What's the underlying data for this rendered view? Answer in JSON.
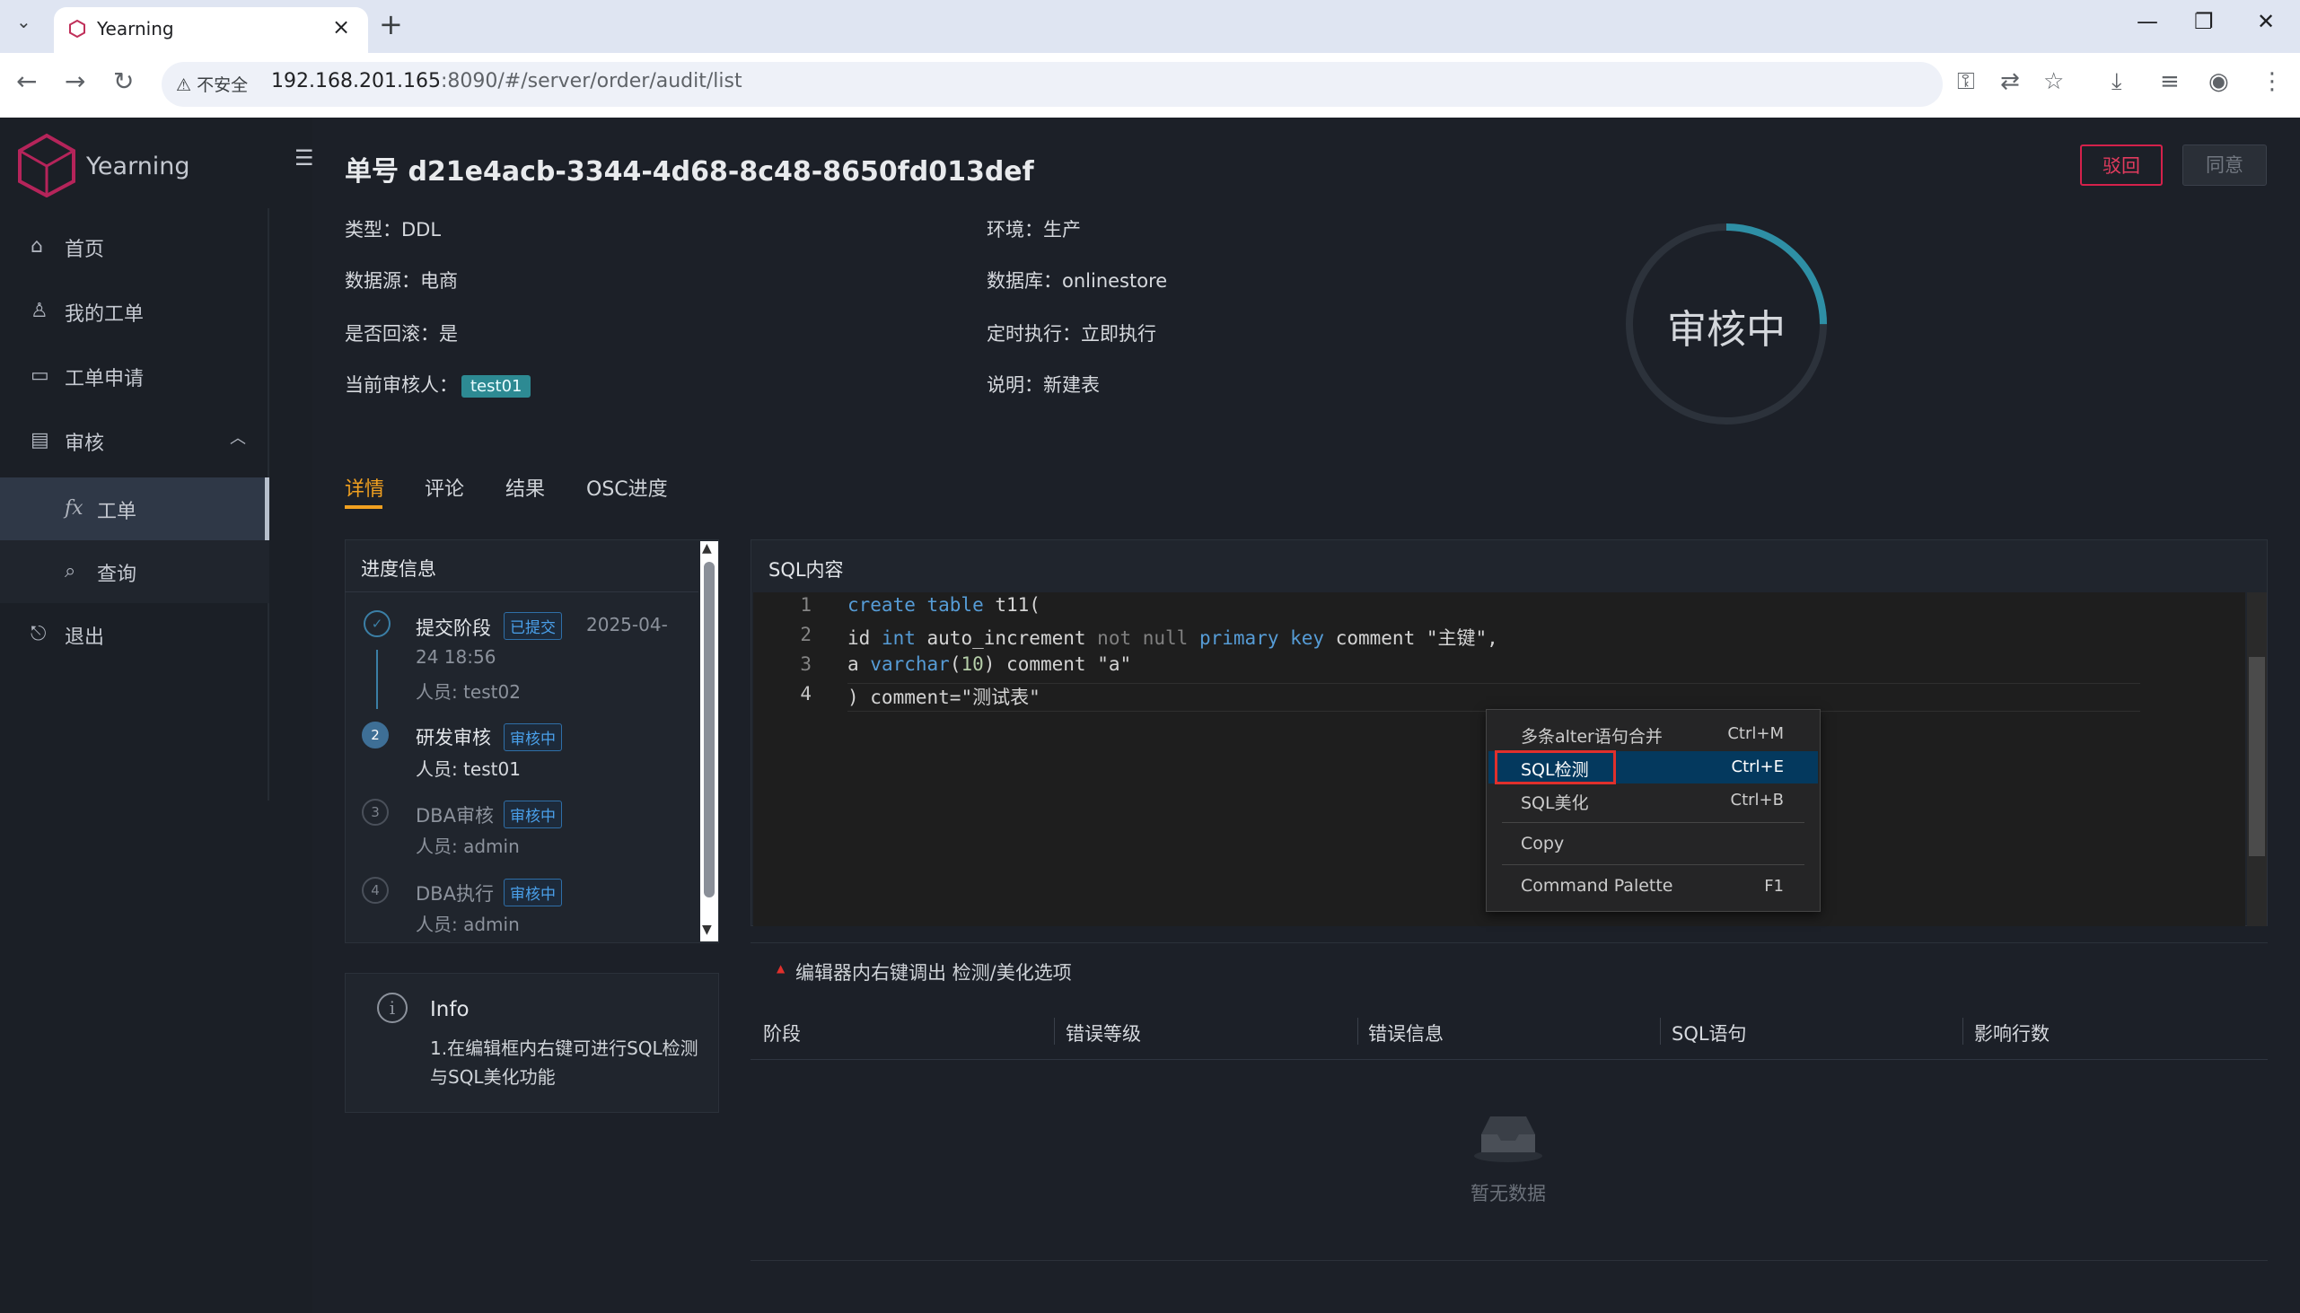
{
  "browser": {
    "tab_title": "Yearning",
    "insecure_label": "不安全",
    "url_host": "192.168.201.165",
    "url_rest": ":8090/#/server/order/audit/list"
  },
  "sidebar": {
    "brand": "Yearning",
    "items": [
      {
        "label": "首页",
        "icon": "home-icon"
      },
      {
        "label": "我的工单",
        "icon": "user-icon"
      },
      {
        "label": "工单申请",
        "icon": "monitor-icon"
      },
      {
        "label": "审核",
        "icon": "audit-icon"
      },
      {
        "label": "工单",
        "icon": "fx-icon"
      },
      {
        "label": "查询",
        "icon": "search-icon"
      },
      {
        "label": "退出",
        "icon": "logout-icon"
      }
    ]
  },
  "order": {
    "title": "单号 d21e4acb-3344-4d68-8c48-8650fd013def",
    "reject_label": "驳回",
    "agree_label": "同意",
    "type": "类型：DDL",
    "datasource": "数据源：电商",
    "rollback": "是否回滚：是",
    "reviewer_label": "当前审核人：",
    "reviewer": "test01",
    "env": "环境：生产",
    "database": "数据库：onlinestore",
    "schedule": "定时执行：立即执行",
    "remark": "说明：新建表",
    "status": "审核中",
    "status_progress": 0.25
  },
  "tabs": [
    "详情",
    "评论",
    "结果",
    "OSC进度"
  ],
  "progress": {
    "title": "进度信息",
    "steps": [
      {
        "num": "",
        "title": "提交阶段",
        "badge": "已提交",
        "time": "2025-04-",
        "time2": "24 18:56",
        "person": "人员: test02"
      },
      {
        "num": "2",
        "title": "研发审核",
        "badge": "审核中",
        "person": "人员: test01"
      },
      {
        "num": "3",
        "title": "DBA审核",
        "badge": "审核中",
        "person": "人员: admin"
      },
      {
        "num": "4",
        "title": "DBA执行",
        "badge": "审核中",
        "person": "人员: admin"
      }
    ]
  },
  "info_card": {
    "title": "Info",
    "text": "1.在编辑框内右键可进行SQL检测与SQL美化功能"
  },
  "sql": {
    "title": "SQL内容",
    "line_numbers": [
      "1",
      "2",
      "3",
      "4"
    ]
  },
  "context_menu": {
    "items": [
      {
        "label": "多条alter语句合并",
        "key": "Ctrl+M"
      },
      {
        "label": "SQL检测",
        "key": "Ctrl+E"
      },
      {
        "label": "SQL美化",
        "key": "Ctrl+B"
      },
      {
        "label": "Copy",
        "key": ""
      },
      {
        "label": "Command Palette",
        "key": "F1"
      }
    ]
  },
  "hint": "编辑器内右键调出 检测/美化选项",
  "result_table": {
    "columns": [
      "阶段",
      "错误等级",
      "错误信息",
      "SQL语句",
      "影响行数"
    ],
    "empty_text": "暂无数据"
  },
  "colors": {
    "accent_orange": "#f0a020",
    "reject_red": "#d4214b",
    "reviewer_tag": "#2d8a93",
    "ring": "#2e8fa5"
  }
}
